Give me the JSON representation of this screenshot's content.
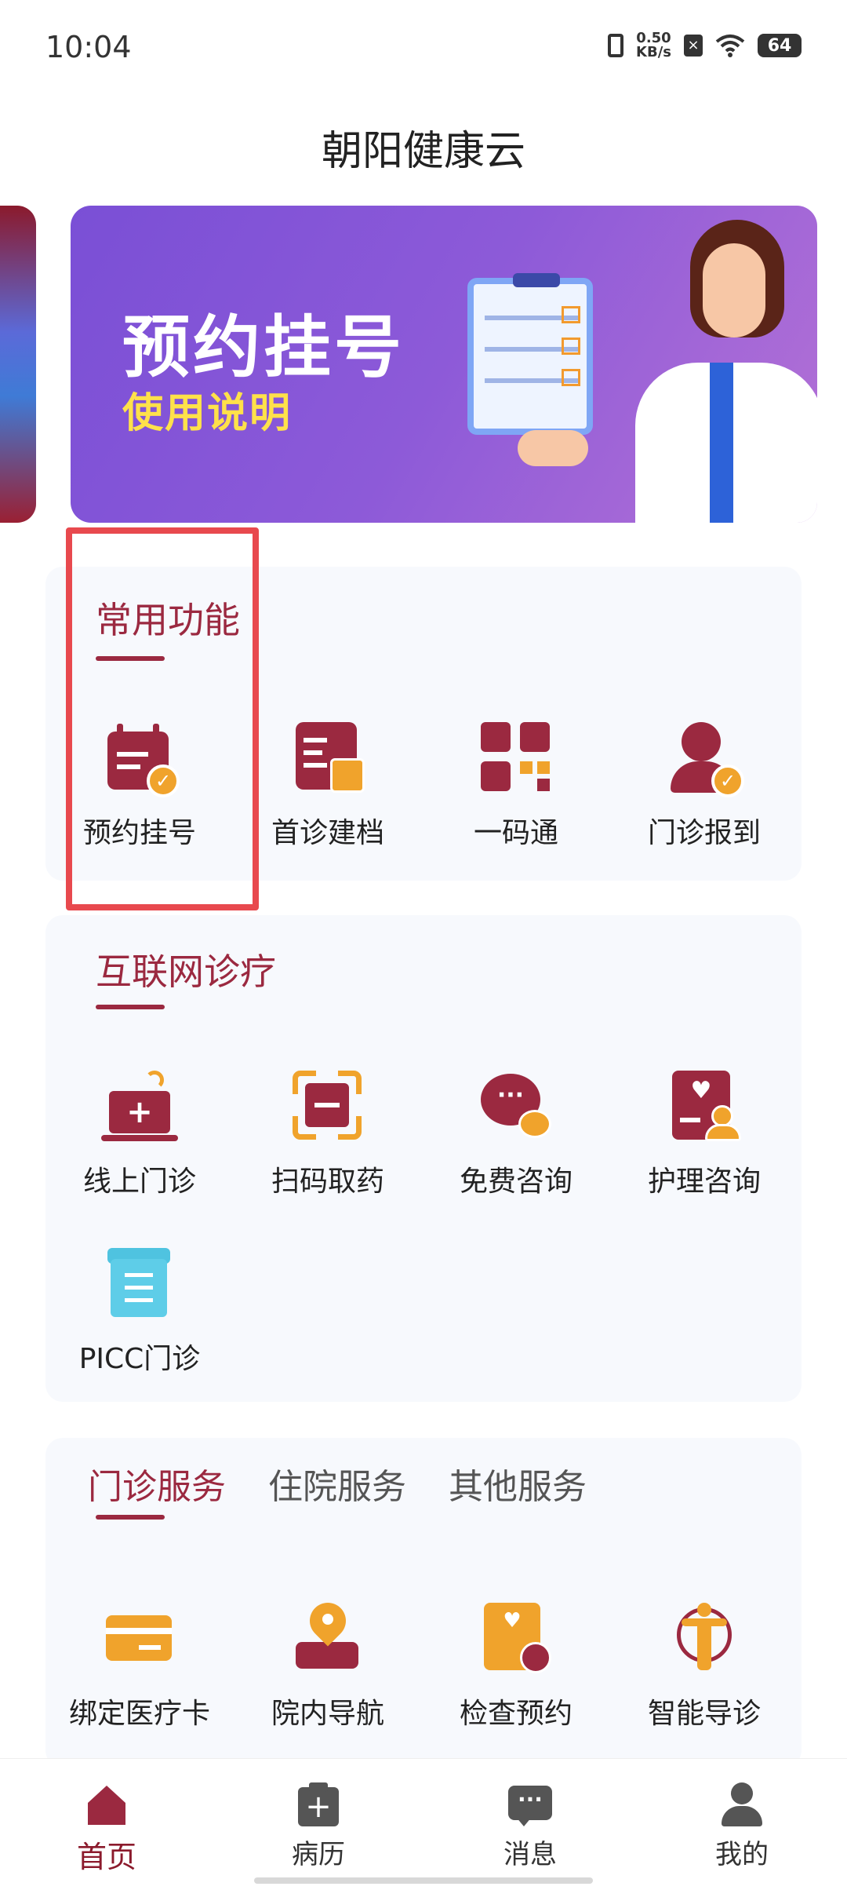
{
  "status_bar": {
    "time": "10:04",
    "net_speed_value": "0.50",
    "net_speed_unit": "KB/s",
    "battery": "64"
  },
  "header": {
    "title": "朝阳健康云"
  },
  "banner": {
    "title": "预约挂号",
    "subtitle": "使用说明"
  },
  "common_functions": {
    "title": "常用功能",
    "items": [
      {
        "label": "预约挂号",
        "icon": "calendar-check-icon"
      },
      {
        "label": "首诊建档",
        "icon": "profile-card-icon"
      },
      {
        "label": "一码通",
        "icon": "qr-code-icon"
      },
      {
        "label": "门诊报到",
        "icon": "user-check-icon"
      }
    ]
  },
  "internet_clinic": {
    "title": "互联网诊疗",
    "items": [
      {
        "label": "线上门诊",
        "icon": "laptop-medical-icon"
      },
      {
        "label": "扫码取药",
        "icon": "scan-icon"
      },
      {
        "label": "免费咨询",
        "icon": "chat-bubbles-icon"
      },
      {
        "label": "护理咨询",
        "icon": "nurse-consult-icon"
      },
      {
        "label": "PICC门诊",
        "icon": "document-list-icon"
      }
    ]
  },
  "services": {
    "tabs": [
      {
        "label": "门诊服务",
        "active": true
      },
      {
        "label": "住院服务",
        "active": false
      },
      {
        "label": "其他服务",
        "active": false
      }
    ],
    "items": [
      {
        "label": "绑定医疗卡",
        "icon": "card-icon"
      },
      {
        "label": "院内导航",
        "icon": "map-pin-icon"
      },
      {
        "label": "检查预约",
        "icon": "clock-report-icon"
      },
      {
        "label": "智能导诊",
        "icon": "body-guide-icon"
      }
    ]
  },
  "bottom_nav": [
    {
      "label": "首页",
      "icon": "home-icon",
      "active": true
    },
    {
      "label": "病历",
      "icon": "medical-record-icon",
      "active": false
    },
    {
      "label": "消息",
      "icon": "message-icon",
      "active": false
    },
    {
      "label": "我的",
      "icon": "user-icon",
      "active": false
    }
  ],
  "colors": {
    "brand": "#9b2940",
    "accent": "#f0a32c",
    "highlight_box": "#e8494e",
    "card_bg": "#f7f9fd"
  }
}
